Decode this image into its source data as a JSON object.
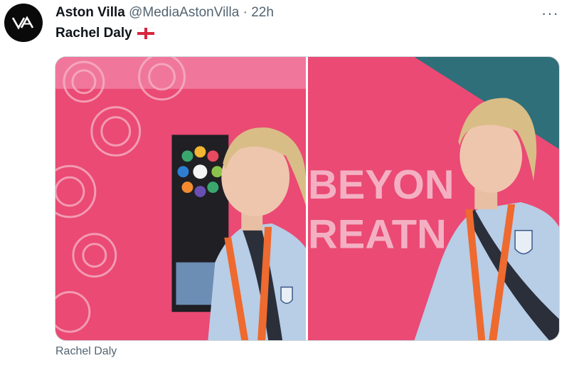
{
  "tweet": {
    "author": {
      "name": "Aston Villa",
      "handle": "@MediaAstonVilla",
      "separator": "·",
      "time": "22h",
      "avatar_icon": "aston-villa-logo-icon"
    },
    "more_label": "···",
    "text": "Rachel Daly",
    "flag_icon": "england-flag-icon",
    "media": [
      {
        "alt": "Rachel Daly",
        "icon": "photo-rachel-daly-1"
      },
      {
        "alt": "Rachel Daly",
        "icon": "photo-rachel-daly-2",
        "background_text": [
          "BEYON",
          "REATN"
        ]
      }
    ],
    "caption": "Rachel Daly"
  },
  "colors": {
    "text_primary": "#0f1419",
    "text_secondary": "#536471",
    "border": "#cfd9de",
    "photo_pink": "#e8456f",
    "jacket_blue": "#b8cde6"
  }
}
